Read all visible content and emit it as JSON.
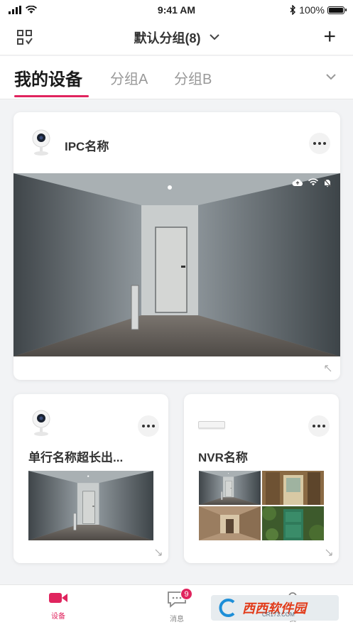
{
  "status": {
    "time": "9:41 AM",
    "battery": "100%"
  },
  "nav": {
    "title": "默认分组(8)",
    "add": "+",
    "left_icon": "scan-grid-icon",
    "chevron_icon": "chevron-down-icon"
  },
  "tabs": [
    {
      "label": "我的设备"
    },
    {
      "label": "分组A"
    },
    {
      "label": "分组B"
    }
  ],
  "cards": {
    "main": {
      "name": "IPC名称",
      "status_icons": [
        "cloud-upload-icon",
        "wifi-icon",
        "bell-off-icon"
      ]
    },
    "small1": {
      "name": "单行名称超长出..."
    },
    "small2": {
      "name": "NVR名称"
    }
  },
  "tabbar": {
    "items": [
      {
        "label": "设备",
        "icon": "camera-icon"
      },
      {
        "label": "消息",
        "icon": "message-icon",
        "badge": "9"
      },
      {
        "label": "我",
        "icon": "user-icon"
      }
    ]
  },
  "watermark": {
    "brand": "西西软件园",
    "url": "CR173.COM"
  },
  "colors": {
    "accent": "#e0245e"
  }
}
